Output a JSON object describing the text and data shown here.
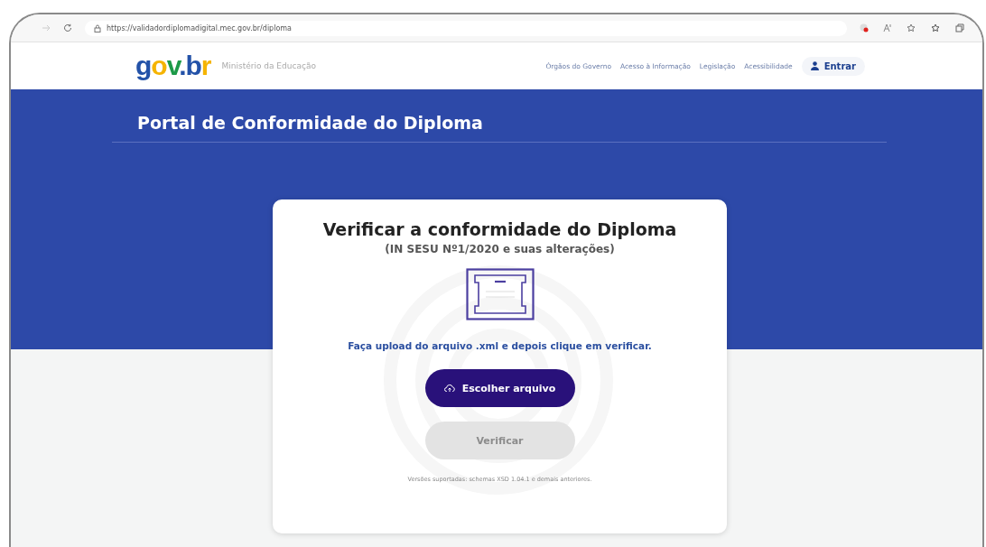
{
  "browser": {
    "url": "https://validadordiplomadigital.mec.gov.br/diploma"
  },
  "header": {
    "logo": "gov.br",
    "ministry": "Ministério da Educação",
    "links": [
      "Órgãos do Governo",
      "Acesso à Informação",
      "Legislação",
      "Acessibilidade"
    ],
    "login": "Entrar"
  },
  "banner": {
    "title": "Portal de Conformidade do Diploma"
  },
  "card": {
    "title": "Verificar a conformidade do Diploma",
    "subtitle": "(IN SESU Nº1/2020 e suas alterações)",
    "instruction": "Faça upload do arquivo .xml e depois clique em verificar.",
    "buttons": [
      {
        "label": "Escolher arquivo",
        "kind": "upload",
        "disabled": false
      },
      {
        "label": "Verificar",
        "kind": "submit",
        "disabled": true
      }
    ],
    "note": "Versões suportadas: schemas XSD 1.04.1 e demais anteriores."
  }
}
